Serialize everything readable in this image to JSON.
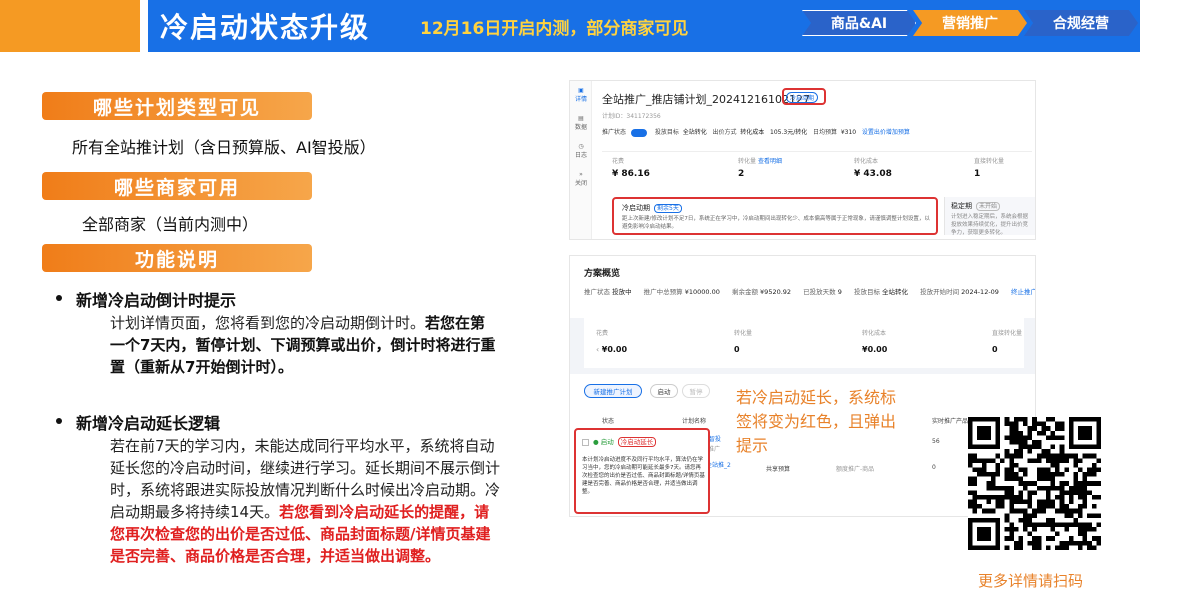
{
  "header": {
    "title": "冷启动状态升级",
    "subtitle": "12月16日开启内测，部分商家可见",
    "nav": [
      "商品&AI",
      "营销推广",
      "合规经营"
    ]
  },
  "sections": [
    {
      "heading": "哪些计划类型可见",
      "body": "所有全站推计划（含日预算版、AI智投版）"
    },
    {
      "heading": "哪些商家可用",
      "body": "全部商家（当前内测中）"
    },
    {
      "heading": "功能说明"
    }
  ],
  "features": [
    {
      "title": "新增冷启动倒计时提示",
      "text_a": "计划详情页面，您将看到您的冷启动期倒计时。",
      "text_b": "若您在第一个7天内，暂停计划、下调预算或出价，倒计时将进行重置（重新从7开始倒计时）。"
    },
    {
      "title": "新增冷启动延长逻辑",
      "text_a": "若在前7天的学习内，未能达成同行平均水平，系统将自动延长您的冷启动时间，继续进行学习。延长期间不展示倒计时，系统将跟进实际投放情况判断什么时候出冷启动期。冷启动期最多将持续14天。",
      "text_red": "若您看到冷启动延长的提醒，请您再次检查您的出价是否过低、商品封面标题/详情页基建是否完善、商品价格是否合理，并适当做出调整。"
    }
  ],
  "screenshot1": {
    "sidebar": [
      "详情",
      "数据",
      "日志",
      "关闭"
    ],
    "plan_title": "全站推广_推店铺计划_20241216102127",
    "status_tag": "冷启动期",
    "plan_id": "计划ID：341172356",
    "row": {
      "status_label": "推广状态",
      "target_label": "投放目标",
      "target_value": "全站转化",
      "bid_label": "出价方式",
      "bid_value": "转化成本",
      "price": "105.3元/转化",
      "budget_label": "日均预算",
      "budget_value": "¥310",
      "link": "设置出价增加预算"
    },
    "metrics": [
      {
        "label": "花费",
        "value": "¥ 86.16"
      },
      {
        "label": "转化量",
        "extra": "查看明细",
        "value": "2"
      },
      {
        "label": "转化成本",
        "value": "¥ 43.08"
      },
      {
        "label": "直接转化量",
        "value": "1"
      }
    ],
    "cold_box": {
      "title": "冷启动期",
      "tag": "剩余5天",
      "text": "距上次新建/修改计划不足7日，系统正在学习中，冷启动期间出现转化少、成本偏高等属于正常现象，请谨慎调整计划设置，以避免影响冷启动结果。"
    },
    "stable_box": {
      "title": "稳定期",
      "tag": "未开始",
      "text": "计划进入稳定期后，系统会根据投放效果持续优化，提升出价竞争力，获取更多转化。"
    }
  },
  "screenshot2": {
    "title": "方案概览",
    "row": {
      "status_label": "推广状态",
      "status_value": "投放中",
      "budget_label": "推广中总预算",
      "budget_value": "¥10000.00",
      "remain_label": "剩余金额",
      "remain_value": "¥9520.92",
      "days_label": "已投放天数",
      "days_value": "9",
      "target_label": "投放目标",
      "target_value": "全站转化",
      "start_label": "投放开始时间",
      "start_value": "2024-12-09",
      "link": "终止推广"
    },
    "metrics": [
      {
        "label": "花费",
        "value": "¥0.00"
      },
      {
        "label": "转化量",
        "value": "0"
      },
      {
        "label": "转化成本",
        "value": "¥0.00"
      },
      {
        "label": "直接转化量",
        "value": "0"
      }
    ],
    "new_plan_button": "新建推广计划",
    "btn_start": "启动",
    "btn_pause": "暂停",
    "col_status": "状态",
    "col_plan": "计划名称",
    "col_products": "实时推广产品",
    "row1": {
      "status": "启动",
      "tag": "冷启动延长",
      "name": "全站推_AI智投",
      "type": "类型",
      "type_value": "全站推广",
      "count": "56"
    },
    "row2": {
      "name": "全站推_2",
      "col": "共享预算",
      "budget": "额度推广-商品",
      "count": "0"
    },
    "tip": "本计划冷启动进度不及同行平均水平，算法仍在学习当中，您的冷启动期可能延长最多7天。请您再次检查您的出价是否过低、商品封面标题/详情页基建是否完善、商品价格是否合理，并适当做出调整。"
  },
  "annotation": "若冷启动延长，系统标签将变为红色，且弹出提示",
  "qr_caption": "更多详情请扫码",
  "colors": {
    "brand_blue": "#1870e6",
    "orange": "#f59a23",
    "red": "#e02020",
    "annotation": "#e8822a"
  }
}
